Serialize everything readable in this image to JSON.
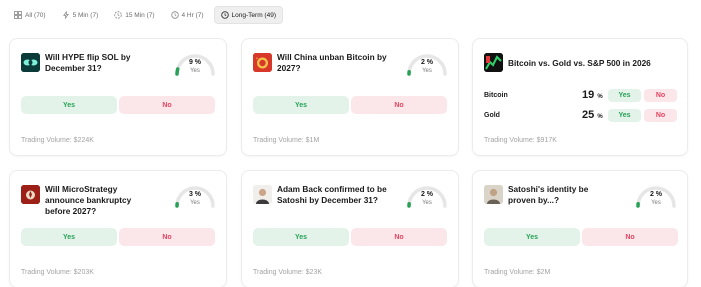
{
  "filters": [
    {
      "label": "All (70)",
      "icon": "grid-icon"
    },
    {
      "label": "5 Min (7)",
      "icon": "bolt-icon"
    },
    {
      "label": "15 Min (7)",
      "icon": "timer-icon"
    },
    {
      "label": "4 Hr (7)",
      "icon": "clock-icon"
    },
    {
      "label": "Long-Term (49)",
      "icon": "clock-icon"
    }
  ],
  "active_filter": "Long-Term (49)",
  "colors": {
    "yes_text": "#27a255",
    "yes_bg": "#e4f3ea",
    "no_text": "#e14560",
    "no_bg": "#fbe6ea",
    "gauge_track": "#e6e6e6",
    "gauge_fill": "#27a255"
  },
  "buttons": {
    "yes": "Yes",
    "no": "No"
  },
  "gauge_caption": "Yes",
  "markets": [
    {
      "question": "Will HYPE flip SOL by December 31?",
      "percent": "9 %",
      "percent_value": 9,
      "volume": "Trading Volume: $224K",
      "thumb": "hype-logo"
    },
    {
      "question": "Will China unban Bitcoin by 2027?",
      "percent": "2 %",
      "percent_value": 2,
      "volume": "Trading Volume: $1M",
      "thumb": "china-flag"
    },
    {
      "question": "Will MicroStrategy announce bankruptcy before 2027?",
      "percent": "3 %",
      "percent_value": 3,
      "volume": "Trading Volume: $203K",
      "thumb": "microstrategy-logo"
    },
    {
      "question": "Adam Back confirmed to be Satoshi by December 31?",
      "percent": "2 %",
      "percent_value": 2,
      "volume": "Trading Volume: $23K",
      "thumb": "person-photo"
    },
    {
      "question": "Satoshi's identity be proven by...?",
      "percent": "2 %",
      "percent_value": 2,
      "volume": "Trading Volume: $2M",
      "thumb": "person-photo"
    }
  ],
  "multi_market": {
    "question": "Bitcoin vs. Gold vs. S&P 500 in 2026",
    "thumb": "chart-logo",
    "outcomes": [
      {
        "name": "Bitcoin",
        "percent": "19",
        "unit": "%"
      },
      {
        "name": "Gold",
        "percent": "25",
        "unit": "%"
      }
    ],
    "volume": "Trading Volume: $917K"
  }
}
